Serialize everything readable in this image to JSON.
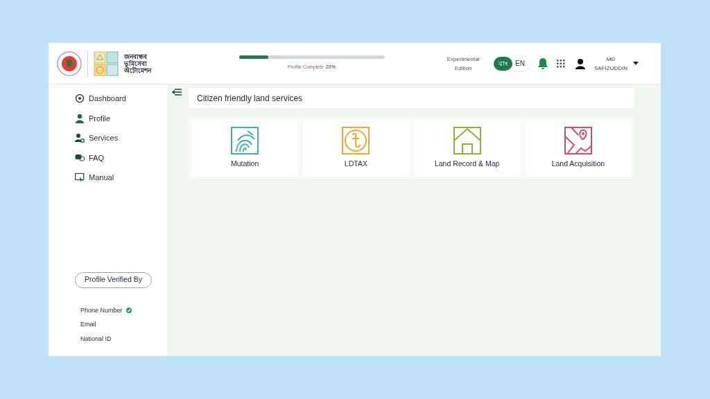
{
  "header": {
    "logo_text": [
      "জনবান্ধব",
      "ভূমিসেবা",
      "অটোমেশন"
    ],
    "progress": {
      "level": 0.2,
      "label": "Profile Complete",
      "value": "20%"
    },
    "edition": "Experimental Edition",
    "languages": [
      {
        "label": "বাং",
        "selected": true
      },
      {
        "label": "EN",
        "selected": false
      }
    ],
    "user": {
      "name": "MD SAFIZUDDIN"
    }
  },
  "sidebar": {
    "items": [
      {
        "label": "Dashboard",
        "kind": "dashboard"
      },
      {
        "label": "Profile",
        "kind": "profile"
      },
      {
        "label": "Services",
        "kind": "services"
      },
      {
        "label": "FAQ",
        "kind": "faq"
      },
      {
        "label": "Manual",
        "kind": "manual"
      }
    ],
    "verified_button": "Profile Verified By",
    "verifications": [
      {
        "label": "Phone Number",
        "verified": true
      },
      {
        "label": "Email",
        "verified": false
      },
      {
        "label": "National ID",
        "verified": false
      }
    ]
  },
  "main": {
    "title": "Citizen friendly land services",
    "services": [
      {
        "label": "Mutation",
        "kind": "mutation",
        "color": "#3fb0a8"
      },
      {
        "label": "LDTAX",
        "kind": "ldtax",
        "color": "#f0a830"
      },
      {
        "label": "Land Record & Map",
        "kind": "record",
        "color": "#8db040"
      },
      {
        "label": "Land Acquisition",
        "kind": "acquisition",
        "color": "#d84a6a"
      }
    ]
  }
}
